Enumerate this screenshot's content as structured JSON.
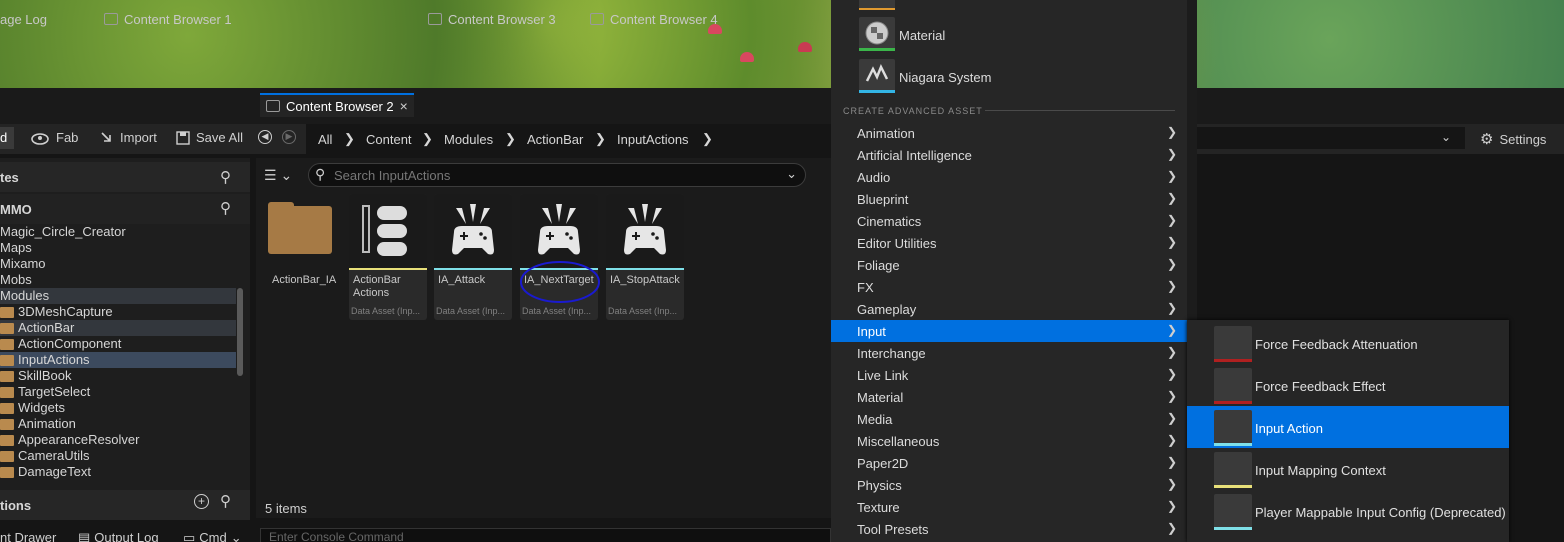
{
  "tabs": [
    {
      "label": "age Log",
      "active": false
    },
    {
      "label": "Content Browser 1",
      "active": false
    },
    {
      "label": "Content Browser 2",
      "active": true
    },
    {
      "label": "Content Browser 3",
      "active": false
    },
    {
      "label": "Content Browser 4",
      "active": false
    }
  ],
  "tab_close": "×",
  "toolbar": {
    "add_fragment": "d",
    "fab": "Fab",
    "import": "Import",
    "save_all": "Save All",
    "settings": "Settings"
  },
  "breadcrumb": [
    "All",
    "Content",
    "Modules",
    "ActionBar",
    "InputActions"
  ],
  "left_panel": {
    "favorites_header": "tes",
    "project_header": "MMO",
    "collections_header": "tions",
    "tree": [
      {
        "label": "Magic_Circle_Creator",
        "folder": false,
        "highlight": false
      },
      {
        "label": "Maps",
        "folder": false,
        "highlight": false
      },
      {
        "label": "Mixamo",
        "folder": false,
        "highlight": false
      },
      {
        "label": "Mobs",
        "folder": false,
        "highlight": false
      },
      {
        "label": "Modules",
        "folder": false,
        "highlight": true
      },
      {
        "label": "3DMeshCapture",
        "folder": true,
        "highlight": false
      },
      {
        "label": "ActionBar",
        "folder": true,
        "highlight": true
      },
      {
        "label": "ActionComponent",
        "folder": true,
        "highlight": false
      },
      {
        "label": "InputActions",
        "folder": true,
        "highlight": "selected"
      },
      {
        "label": "SkillBook",
        "folder": true,
        "highlight": false
      },
      {
        "label": "TargetSelect",
        "folder": true,
        "highlight": false
      },
      {
        "label": "Widgets",
        "folder": true,
        "highlight": false
      },
      {
        "label": "Animation",
        "folder": true,
        "highlight": false
      },
      {
        "label": "AppearanceResolver",
        "folder": true,
        "highlight": false
      },
      {
        "label": "CameraUtils",
        "folder": true,
        "highlight": false
      },
      {
        "label": "DamageText",
        "folder": true,
        "highlight": false
      }
    ]
  },
  "search": {
    "placeholder": "Search InputActions"
  },
  "assets": [
    {
      "name": "ActionBar_IA",
      "type": "",
      "kind": "folder",
      "bar_color": ""
    },
    {
      "name": "ActionBar Actions",
      "type": "Data Asset (Inp...",
      "kind": "mapping",
      "bar_color": "#e8e07a"
    },
    {
      "name": "IA_Attack",
      "type": "Data Asset (Inp...",
      "kind": "action",
      "bar_color": "#7fe0e8"
    },
    {
      "name": "IA_NextTarget",
      "type": "Data Asset (Inp...",
      "kind": "action",
      "bar_color": "#7fe0e8"
    },
    {
      "name": "IA_StopAttack",
      "type": "Data Asset (Inp...",
      "kind": "action",
      "bar_color": "#7fe0e8"
    }
  ],
  "item_count": "5 items",
  "dock": {
    "content_drawer": "nt Drawer",
    "output_log": "Output Log",
    "cmd": "Cmd",
    "console_placeholder": "Enter Console Command"
  },
  "menu": {
    "favorites": [
      {
        "label": "Material",
        "bar_color": "#3bb54a",
        "icon": "material-sphere-icon"
      },
      {
        "label": "Niagara System",
        "bar_color": "#33b5e5",
        "icon": "niagara-icon"
      }
    ],
    "section_label": "CREATE ADVANCED ASSET",
    "items": [
      "Animation",
      "Artificial Intelligence",
      "Audio",
      "Blueprint",
      "Cinematics",
      "Editor Utilities",
      "Foliage",
      "FX",
      "Gameplay",
      "Input",
      "Interchange",
      "Live Link",
      "Material",
      "Media",
      "Miscellaneous",
      "Paper2D",
      "Physics",
      "Texture",
      "Tool Presets"
    ],
    "selected": "Input",
    "arrow": "❯"
  },
  "submenu": [
    {
      "label": "Force Feedback Attenuation",
      "bar_color": "#b02020",
      "icon": "cube-icon",
      "selected": false
    },
    {
      "label": "Force Feedback Effect",
      "bar_color": "#b02020",
      "icon": "controller-vibration-icon",
      "selected": false
    },
    {
      "label": "Input Action",
      "bar_color": "#7fe0e8",
      "icon": "input-action-icon",
      "selected": true
    },
    {
      "label": "Input Mapping Context",
      "bar_color": "#e8e07a",
      "icon": "mapping-context-icon",
      "selected": false
    },
    {
      "label": "Player Mappable Input Config (Deprecated)",
      "bar_color": "#7fe0e8",
      "icon": "keyboard-icon",
      "selected": false
    }
  ]
}
